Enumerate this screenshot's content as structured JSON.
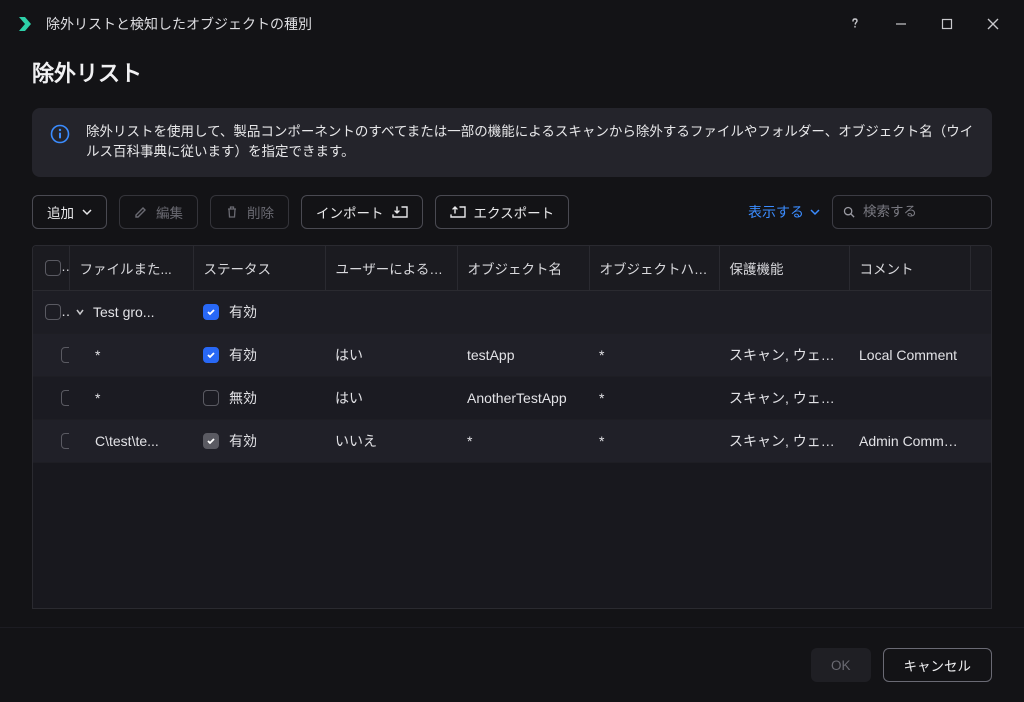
{
  "titlebar": {
    "title": "除外リストと検知したオブジェクトの種別"
  },
  "page_title": "除外リスト",
  "info_text": "除外リストを使用して、製品コンポーネントのすべてまたは一部の機能によるスキャンから除外するファイルやフォルダー、オブジェクト名（ウイルス百科事典に従います）を指定できます。",
  "toolbar": {
    "add": "追加",
    "edit": "編集",
    "delete": "削除",
    "import": "インポート",
    "export": "エクスポート",
    "display": "表示する",
    "search_placeholder": "検索する"
  },
  "columns": {
    "file": "ファイルまた...",
    "status": "ステータス",
    "user_added": "ユーザーによる追加",
    "object_name": "オブジェクト名",
    "object_hash": "オブジェクトハッシュ",
    "protection": "保護機能",
    "comment": "コメント"
  },
  "group": {
    "name": "Test gro...",
    "status": "有効",
    "status_checked": true
  },
  "rows": [
    {
      "file": "*",
      "status": "有効",
      "status_checked": true,
      "status_gray": false,
      "user_added": "はい",
      "object_name": "testApp",
      "object_hash": "*",
      "protection": "スキャン, ウェブ脅威...",
      "comment": "Local Comment"
    },
    {
      "file": "*",
      "status": "無効",
      "status_checked": false,
      "status_gray": false,
      "user_added": "はい",
      "object_name": "AnotherTestApp",
      "object_hash": "*",
      "protection": "スキャン, ウェブ脅威...",
      "comment": ""
    },
    {
      "file": "C\\test\\te...",
      "status": "有効",
      "status_checked": true,
      "status_gray": true,
      "user_added": "いいえ",
      "object_name": "*",
      "object_hash": "*",
      "protection": "スキャン, ウェブ脅威...",
      "comment": "Admin Comment"
    }
  ],
  "footer": {
    "ok": "OK",
    "cancel": "キャンセル"
  }
}
